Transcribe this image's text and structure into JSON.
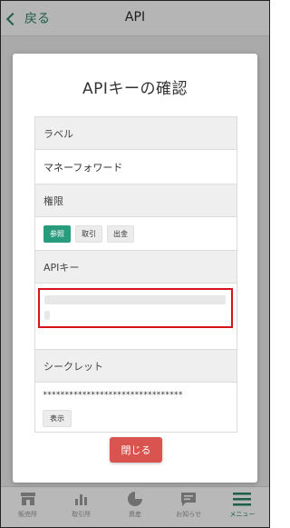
{
  "header": {
    "back_label": "戻る",
    "title": "API"
  },
  "modal": {
    "title": "APIキーの確認",
    "label_header": "ラベル",
    "label_value": "マネーフォワード",
    "permission_header": "権限",
    "permissions": [
      {
        "label": "参照",
        "active": true
      },
      {
        "label": "取引",
        "active": false
      },
      {
        "label": "出金",
        "active": false
      }
    ],
    "apikey_header": "APIキー",
    "secret_header": "シークレット",
    "secret_value": "********************************",
    "show_label": "表示",
    "close_label": "閉じる"
  },
  "tabbar": {
    "items": [
      {
        "label": "販売所",
        "icon": "store-icon"
      },
      {
        "label": "取引所",
        "icon": "bar-chart-icon"
      },
      {
        "label": "資産",
        "icon": "pie-chart-icon"
      },
      {
        "label": "お知らせ",
        "icon": "message-icon"
      },
      {
        "label": "メニュー",
        "icon": "menu-icon"
      }
    ]
  },
  "colors": {
    "accent": "#2a9c7e",
    "danger": "#d9534f",
    "highlight": "#d6141d"
  }
}
